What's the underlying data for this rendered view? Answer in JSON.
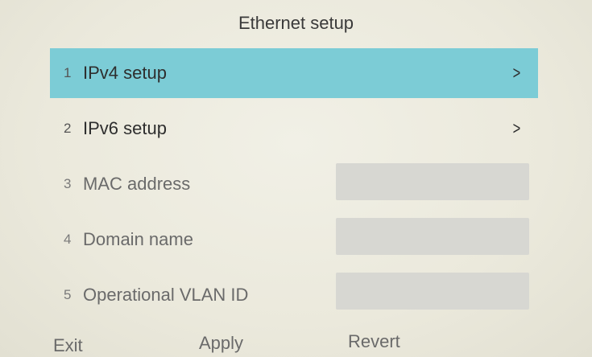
{
  "header": {
    "title": "Ethernet setup"
  },
  "menu": {
    "items": [
      {
        "number": "1",
        "label": "IPv4 setup",
        "selected": true,
        "has_submenu": true,
        "chevron": ">"
      },
      {
        "number": "2",
        "label": "IPv6 setup",
        "selected": false,
        "has_submenu": true,
        "chevron": ">"
      },
      {
        "number": "3",
        "label": "MAC address",
        "selected": false,
        "has_submenu": false,
        "value": ""
      },
      {
        "number": "4",
        "label": "Domain name",
        "selected": false,
        "has_submenu": false,
        "value": ""
      },
      {
        "number": "5",
        "label": "Operational VLAN ID",
        "selected": false,
        "has_submenu": false,
        "value": ""
      }
    ]
  },
  "softkeys": {
    "exit": "Exit",
    "apply": "Apply",
    "revert": "Revert"
  },
  "colors": {
    "selection": "#7cccd6",
    "background": "#ebe9dc",
    "value_box": "#d7d7d2"
  },
  "icons": {
    "submenu": "chevron-right-icon"
  }
}
